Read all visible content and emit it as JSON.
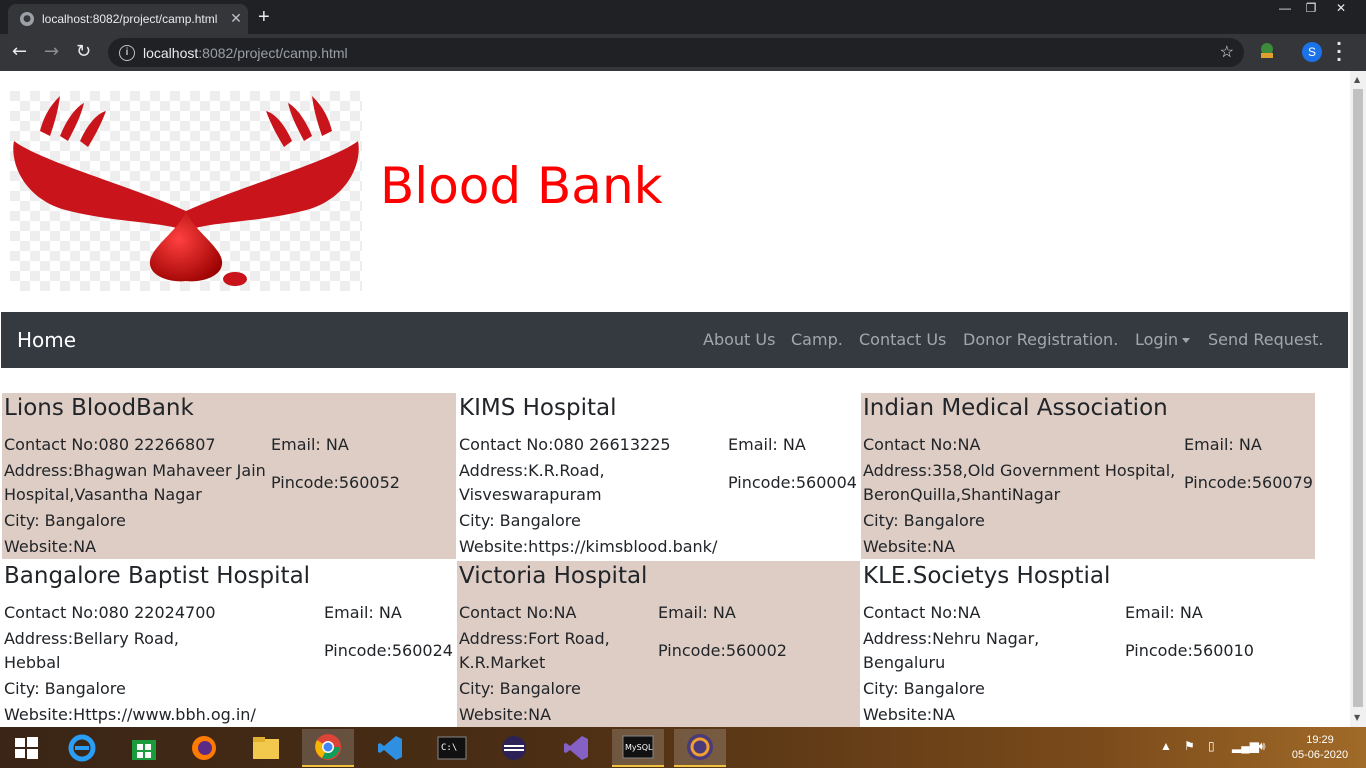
{
  "browser": {
    "tab_title": "localhost:8082/project/camp.html",
    "url_host": "localhost",
    "url_path": ":8082/project/camp.html",
    "profile_initial": "S",
    "new_tab": "+",
    "close_tab": "✕"
  },
  "site": {
    "title": "Blood Bank",
    "title_color": "#ff0000",
    "nav": {
      "brand": "Home",
      "links": [
        "About Us",
        "Camp.",
        "Contact Us",
        "Donor Registration.",
        "Login",
        "Send Request."
      ]
    }
  },
  "camps": [
    {
      "name": "Lions BloodBank",
      "contact": "Contact No:080 22266807",
      "email": "Email: NA",
      "address_1": "Address:Bhagwan Mahaveer Jain",
      "address_2": "Hospital,Vasantha Nagar",
      "pincode": "Pincode:560052",
      "city": "City: Bangalore",
      "website": "Website:NA"
    },
    {
      "name": "KIMS Hospital",
      "contact": "Contact No:080 26613225",
      "email": "Email: NA",
      "address_1": "Address:K.R.Road,",
      "address_2": "Visveswarapuram",
      "pincode": "Pincode:560004",
      "city": "City: Bangalore",
      "website": "Website:https://kimsblood.bank/"
    },
    {
      "name": "Indian Medical Association",
      "contact": "Contact No:NA",
      "email": "Email: NA",
      "address_1": "Address:358,Old Government Hospital,",
      "address_2": "BeronQuilla,ShantiNagar",
      "pincode": "Pincode:560079",
      "city": "City: Bangalore",
      "website": "Website:NA"
    },
    {
      "name": "Bangalore Baptist Hospital",
      "contact": "Contact No:080 22024700",
      "email": "Email: NA",
      "address_1": "Address:Bellary Road,",
      "address_2": "Hebbal",
      "pincode": "Pincode:560024",
      "city": "City: Bangalore",
      "website": "Website:Https://www.bbh.og.in/"
    },
    {
      "name": "Victoria Hospital",
      "contact": "Contact No:NA",
      "email": "Email: NA",
      "address_1": "Address:Fort Road,",
      "address_2": "K.R.Market",
      "pincode": "Pincode:560002",
      "city": "City: Bangalore",
      "website": "Website:NA"
    },
    {
      "name": "KLE.Societys Hosptial",
      "contact": "Contact No:NA",
      "email": "Email: NA",
      "address_1": "Address:Nehru Nagar,",
      "address_2": "Bengaluru",
      "pincode": "Pincode:560010",
      "city": "City: Bangalore",
      "website": "Website:NA"
    }
  ],
  "taskbar": {
    "time": "19:29",
    "date": "05-06-2020",
    "apps": [
      "start-icon",
      "internet-explorer-icon",
      "store-icon",
      "firefox-icon",
      "file-explorer-icon",
      "chrome-icon",
      "vscode-icon",
      "command-prompt-icon",
      "eclipse-icon",
      "visual-studio-icon",
      "mysql-icon",
      "java-ee-ide-icon"
    ]
  },
  "colors": {
    "card_shade": "#decdc4",
    "navbar": "#343a40"
  }
}
